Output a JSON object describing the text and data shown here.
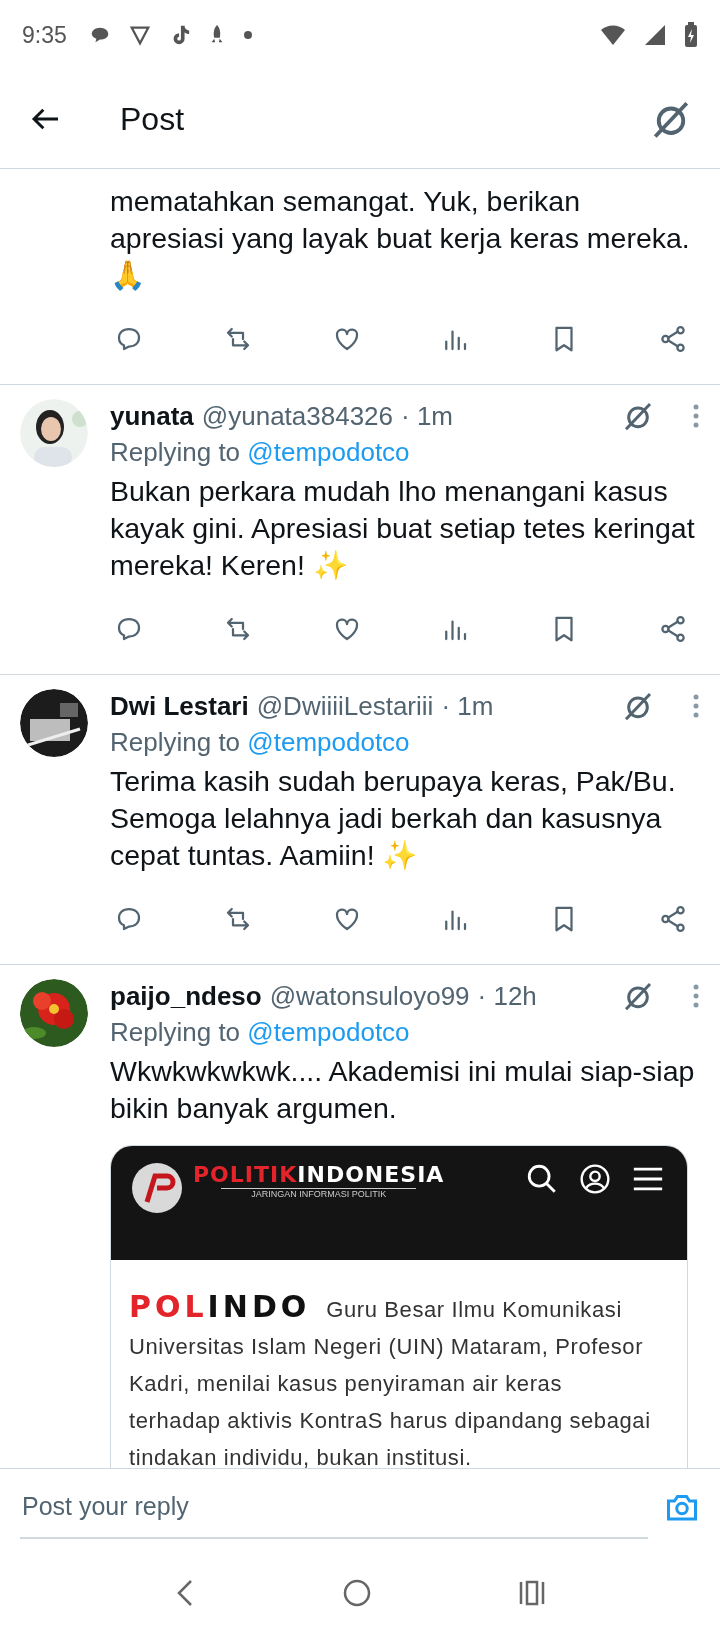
{
  "status_bar": {
    "time": "9:35"
  },
  "header": {
    "title": "Post"
  },
  "posts": [
    {
      "kind": "continued",
      "text": "mematahkan semangat. Yuk, berikan apresiasi yang layak buat kerja keras mereka. 🙏"
    },
    {
      "kind": "reply",
      "name": "yunata",
      "handle": "@yunata384326",
      "time": "· 1m",
      "replying_label": "Replying to",
      "replying_to": "@tempodotco",
      "text": "Bukan perkara mudah lho menangani kasus kayak gini. Apresiasi buat setiap tetes keringat mereka! Keren! ✨"
    },
    {
      "kind": "reply",
      "name": "Dwi Lestari",
      "handle": "@DwiiiiLestariii",
      "time": "· 1m",
      "replying_label": "Replying to",
      "replying_to": "@tempodotco",
      "text": "Terima kasih sudah berupaya keras, Pak/Bu. Semoga lelahnya jadi berkah dan kasusnya cepat tuntas. Aamiin! ✨"
    },
    {
      "kind": "reply",
      "name": "paijo_ndeso",
      "handle": "@watonsuloyo99",
      "time": "· 12h",
      "replying_label": "Replying to",
      "replying_to": "@tempodotco",
      "text": "Wkwkwkwkwk.... Akademisi ini mulai siap-siap bikin banyak argumen.",
      "embed": {
        "logo_parts": [
          {
            "text": "POLITIK",
            "color": "#e3242b"
          },
          {
            "text": "INDONESIA",
            "color": "#ffffff"
          }
        ],
        "tagline": "JARINGAN INFORMASI POLITIK",
        "brand_parts": [
          {
            "text": "POL",
            "color": "#e3242b"
          },
          {
            "text": "INDO",
            "color": "#111111"
          }
        ],
        "text": "Guru Besar Ilmu Komunikasi Universitas Islam Negeri (UIN) Mataram, Profesor Kadri, menilai kasus penyiraman air keras terhadap aktivis KontraS harus dipandang sebagai tindakan individu, bukan institusi."
      }
    }
  ],
  "reply_bar": {
    "placeholder": "Post your reply"
  }
}
